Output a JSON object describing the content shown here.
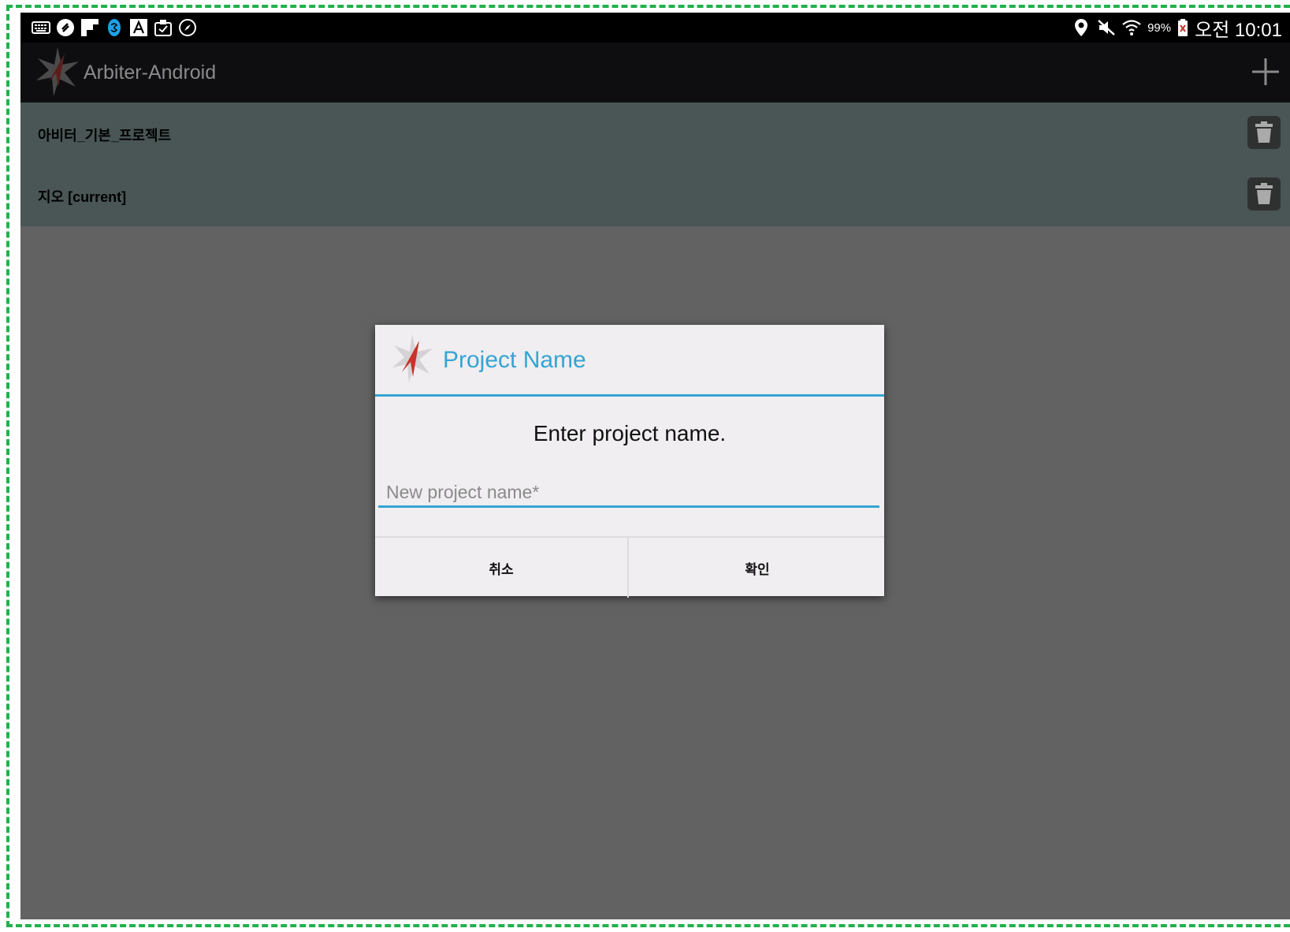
{
  "status_bar": {
    "battery_percent": "99%",
    "clock": "오전 10:01",
    "notification_icons": [
      "keyboard-icon",
      "sync-icon",
      "flipboard-icon",
      "skype-icon",
      "font-a-icon",
      "clipboard-icon",
      "compass-icon"
    ],
    "system_icons": [
      "location-pin-icon",
      "mute-icon",
      "wifi-icon",
      "battery-icon"
    ]
  },
  "action_bar": {
    "title": "Arbiter-Android",
    "add_icon": "plus-icon"
  },
  "projects": [
    {
      "name": "아비터_기본_프로젝트"
    },
    {
      "name": "지오 [current]"
    }
  ],
  "dialog": {
    "title": "Project Name",
    "message": "Enter project name.",
    "input": {
      "value": "",
      "placeholder": "New project name*"
    },
    "cancel_label": "취소",
    "ok_label": "확인"
  },
  "colors": {
    "accent": "#35a4d3",
    "list_background": "#4a5656",
    "dim_background": "#626262",
    "logo_red": "#c8322a"
  }
}
